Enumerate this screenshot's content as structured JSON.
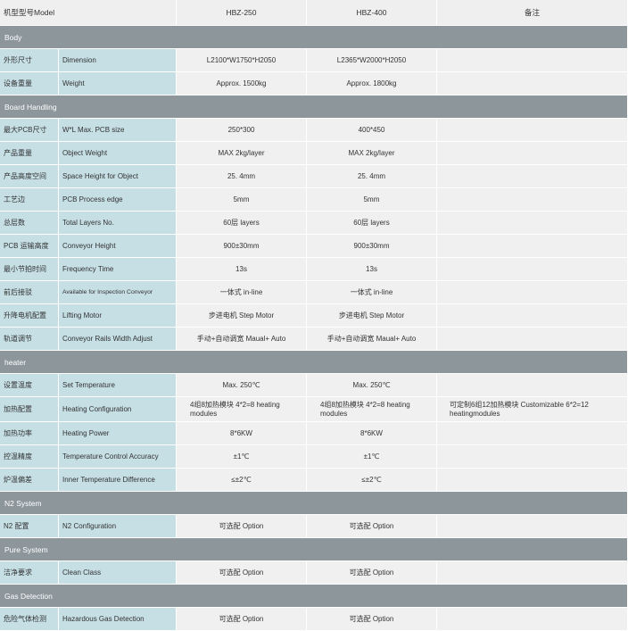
{
  "header": {
    "model_label": "机型型号Model",
    "model_a": "HBZ-250",
    "model_b": "HBZ-400",
    "remark": "备注"
  },
  "sections": {
    "body": "Body",
    "board": "Board Handling",
    "heater": "heater",
    "n2": "N2 System",
    "pure": "Pure System",
    "gas": "Gas Detection"
  },
  "rows": {
    "dimension": {
      "zh": "外形尺寸",
      "en": "Dimension",
      "a": "L2100*W1750*H2050",
      "b": "L2365*W2000*H2050",
      "note": ""
    },
    "weight": {
      "zh": "设备重量",
      "en": "Weight",
      "a": "Approx. 1500kg",
      "b": "Approx. 1800kg",
      "note": ""
    },
    "pcb_size": {
      "zh": "最大PCB尺寸",
      "en": "W*L Max. PCB size",
      "a": "250*300",
      "b": "400*450",
      "note": ""
    },
    "obj_weight": {
      "zh": "产品重量",
      "en": "Object Weight",
      "a": "MAX 2kg/layer",
      "b": "MAX 2kg/layer",
      "note": ""
    },
    "space_height": {
      "zh": "产品高度空间",
      "en": "Space Height for Object",
      "a": "25. 4mm",
      "b": "25. 4mm",
      "note": ""
    },
    "process_edge": {
      "zh": "工艺边",
      "en": "PCB Process edge",
      "a": "5mm",
      "b": "5mm",
      "note": ""
    },
    "layers": {
      "zh": "总层数",
      "en": "Total Layers No.",
      "a": "60层 layers",
      "b": "60层 layers",
      "note": ""
    },
    "conveyor_height": {
      "zh": "PCB 运输高度",
      "en": "Conveyor Height",
      "a": "900±30mm",
      "b": "900±30mm",
      "note": ""
    },
    "frequency": {
      "zh": "最小节拍时间",
      "en": "Frequency Time",
      "a": "13s",
      "b": "13s",
      "note": ""
    },
    "inspection": {
      "zh": "前后接驳",
      "en": "Available for Inspection Conveyor",
      "a": "一体式 in-line",
      "b": "一体式 in-line",
      "note": ""
    },
    "lifting": {
      "zh": "升降电机配置",
      "en": "Lifting Motor",
      "a": "步进电机 Step Motor",
      "b": "步进电机 Step Motor",
      "note": ""
    },
    "rails": {
      "zh": "轨道调节",
      "en": "Conveyor Rails Width Adjust",
      "a": "手动+自动调宽 Maual+ Auto",
      "b": "手动+自动调宽 Maual+ Auto",
      "note": ""
    },
    "set_temp": {
      "zh": "设置温度",
      "en": "Set Temperature",
      "a": "Max. 250℃",
      "b": "Max. 250℃",
      "note": ""
    },
    "heating_cfg": {
      "zh": "加热配置",
      "en": "Heating Configuration",
      "a": "4组8加热模块 4*2=8 heating modules",
      "b": "4组8加热模块 4*2=8 heating modules",
      "note": "可定制6组12加热模块 Customizable 6*2=12 heatingmodules"
    },
    "heating_power": {
      "zh": "加热功率",
      "en": "Heating Power",
      "a": "8*6KW",
      "b": "8*6KW",
      "note": ""
    },
    "temp_accuracy": {
      "zh": "控温精度",
      "en": "Temperature Control Accuracy",
      "a": "±1℃",
      "b": "±1℃",
      "note": ""
    },
    "temp_diff": {
      "zh": "炉温偏差",
      "en": "Inner Temperature Difference",
      "a": "≤±2℃",
      "b": "≤±2℃",
      "note": ""
    },
    "n2_cfg": {
      "zh": "N2 配置",
      "en": "N2 Configuration",
      "a": "可选配 Option",
      "b": "可选配 Option",
      "note": ""
    },
    "clean": {
      "zh": "洁净要求",
      "en": "Clean Class",
      "a": "可选配 Option",
      "b": "可选配 Option",
      "note": ""
    },
    "gas": {
      "zh": "危险气体检测",
      "en": "Hazardous Gas Detection",
      "a": "可选配 Option",
      "b": "可选配 Option",
      "note": ""
    }
  }
}
